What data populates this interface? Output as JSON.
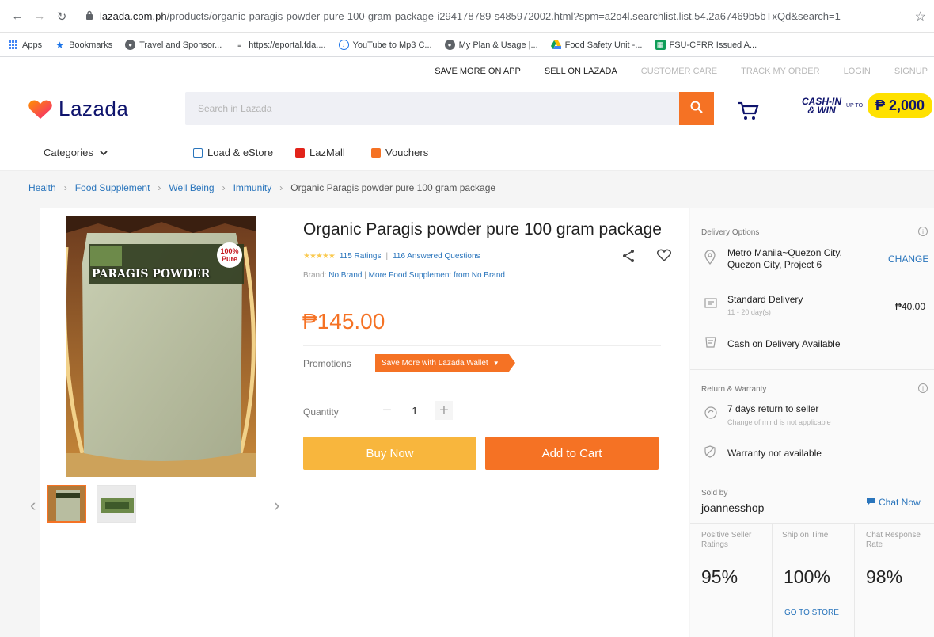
{
  "browser": {
    "url_host": "lazada.com.ph",
    "url_rest": "/products/organic-paragis-powder-pure-100-gram-package-i294178789-s485972002.html?spm=a2o4l.searchlist.list.54.2a67469b5bTxQd&search=1",
    "bookmarks": [
      {
        "label": "Apps",
        "icon": "apps-grid-icon",
        "color": "#4285f4"
      },
      {
        "label": "Bookmarks",
        "icon": "star-icon",
        "color": "#1a73e8"
      },
      {
        "label": "Travel and Sponsor...",
        "icon": "globe-icon",
        "color": "#5f6368"
      },
      {
        "label": "https://eportal.fda....",
        "icon": "site-icon",
        "color": "#3c4043"
      },
      {
        "label": "YouTube to Mp3 C...",
        "icon": "download-icon",
        "color": "#1a73e8"
      },
      {
        "label": "My Plan & Usage |...",
        "icon": "globe-icon",
        "color": "#5f6368"
      },
      {
        "label": "Food Safety Unit -...",
        "icon": "drive-icon",
        "color": "#fbbc04"
      },
      {
        "label": "FSU-CFRR Issued A...",
        "icon": "sheets-icon",
        "color": "#0f9d58"
      }
    ]
  },
  "topnav": {
    "links": [
      {
        "label": "SAVE MORE ON APP",
        "style": "dark"
      },
      {
        "label": "SELL ON LAZADA",
        "style": "dark"
      },
      {
        "label": "CUSTOMER CARE",
        "style": "light"
      },
      {
        "label": "TRACK MY ORDER",
        "style": "light"
      },
      {
        "label": "LOGIN",
        "style": "light"
      },
      {
        "label": "SIGNUP",
        "style": "light"
      }
    ]
  },
  "header": {
    "logo_text": "Lazada",
    "search_placeholder": "Search in Lazada",
    "promo_line1": "CASH-IN",
    "promo_line2": "& WIN",
    "promo_upto": "UP TO",
    "promo_amount": "₱ 2,000"
  },
  "catbar": {
    "categories_label": "Categories",
    "load_label": "Load & eStore",
    "lazmall_label": "LazMall",
    "vouchers_label": "Vouchers"
  },
  "breadcrumb": [
    "Health",
    "Food Supplement",
    "Well Being",
    "Immunity",
    "Organic Paragis powder pure 100 gram package"
  ],
  "product": {
    "title": "Organic Paragis powder pure 100 gram package",
    "image_label_top": "100%",
    "image_label_pure": "Pure",
    "image_label_name": "PARAGIS POWDER",
    "rating_stars": 5,
    "ratings_text": "115 Ratings",
    "answered_text": "116 Answered Questions",
    "brand_label": "Brand:",
    "brand_value": "No Brand",
    "more_from": "More Food Supplement from No Brand",
    "price": "₱145.00",
    "promotions_label": "Promotions",
    "promotion_tag": "Save More with Lazada Wallet",
    "quantity_label": "Quantity",
    "quantity_value": "1",
    "buy_now": "Buy Now",
    "add_to_cart": "Add to Cart"
  },
  "delivery": {
    "section_title": "Delivery Options",
    "location_line1": "Metro Manila~Quezon City,",
    "location_line2": "Quezon City, Project 6",
    "change_label": "CHANGE",
    "standard_label": "Standard Delivery",
    "standard_days": "11 - 20 day(s)",
    "standard_price": "₱40.00",
    "cod_label": "Cash on Delivery Available"
  },
  "warranty": {
    "section_title": "Return & Warranty",
    "return_label": "7 days return to seller",
    "return_sub": "Change of mind is not applicable",
    "warranty_label": "Warranty not available"
  },
  "seller": {
    "sold_by_label": "Sold by",
    "name": "joannesshop",
    "chat_label": "Chat Now",
    "stats": [
      {
        "label": "Positive Seller Ratings",
        "value": "95%"
      },
      {
        "label": "Ship on Time",
        "value": "100%"
      },
      {
        "label": "Chat Response Rate",
        "value": "98%"
      }
    ],
    "go_to_store": "GO TO STORE"
  },
  "colors": {
    "accent": "#f57224",
    "buy_now": "#f8b63d",
    "link": "#2a75bc",
    "brand_navy": "#0f146d"
  }
}
